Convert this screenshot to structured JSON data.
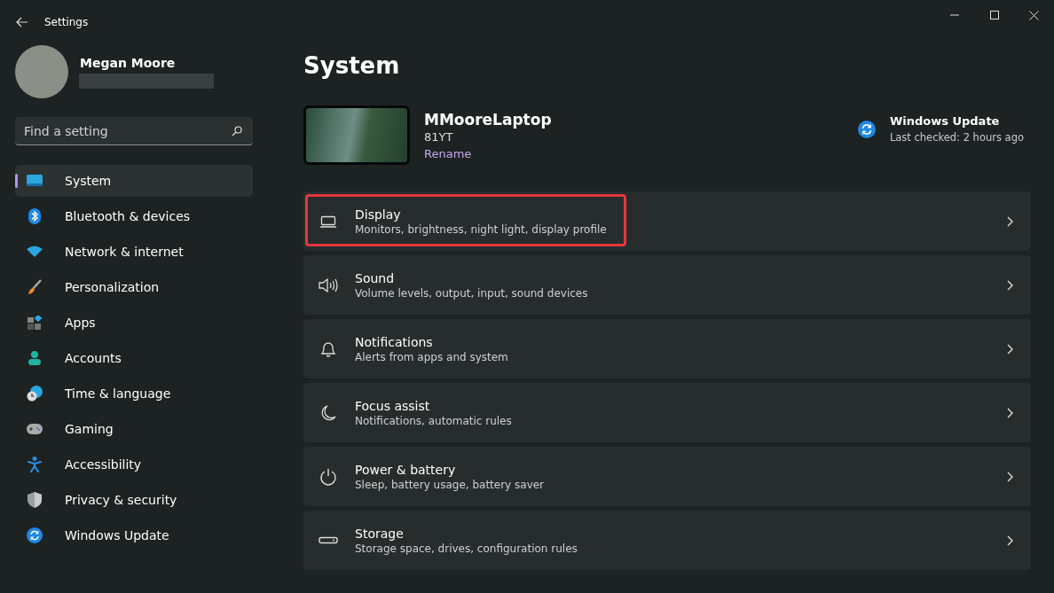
{
  "window": {
    "title": "Settings"
  },
  "profile": {
    "name": "Megan Moore"
  },
  "search": {
    "placeholder": "Find a setting"
  },
  "sidebar": {
    "items": [
      {
        "label": "System",
        "selected": true
      },
      {
        "label": "Bluetooth & devices",
        "selected": false
      },
      {
        "label": "Network & internet",
        "selected": false
      },
      {
        "label": "Personalization",
        "selected": false
      },
      {
        "label": "Apps",
        "selected": false
      },
      {
        "label": "Accounts",
        "selected": false
      },
      {
        "label": "Time & language",
        "selected": false
      },
      {
        "label": "Gaming",
        "selected": false
      },
      {
        "label": "Accessibility",
        "selected": false
      },
      {
        "label": "Privacy & security",
        "selected": false
      },
      {
        "label": "Windows Update",
        "selected": false
      }
    ]
  },
  "page": {
    "title": "System"
  },
  "device": {
    "name": "MMooreLaptop",
    "model": "81YT",
    "rename_link": "Rename"
  },
  "update": {
    "title": "Windows Update",
    "status": "Last checked: 2 hours ago"
  },
  "settings": [
    {
      "title": "Display",
      "subtitle": "Monitors, brightness, night light, display profile",
      "highlighted": true
    },
    {
      "title": "Sound",
      "subtitle": "Volume levels, output, input, sound devices",
      "highlighted": false
    },
    {
      "title": "Notifications",
      "subtitle": "Alerts from apps and system",
      "highlighted": false
    },
    {
      "title": "Focus assist",
      "subtitle": "Notifications, automatic rules",
      "highlighted": false
    },
    {
      "title": "Power & battery",
      "subtitle": "Sleep, battery usage, battery saver",
      "highlighted": false
    },
    {
      "title": "Storage",
      "subtitle": "Storage space, drives, configuration rules",
      "highlighted": false
    }
  ]
}
